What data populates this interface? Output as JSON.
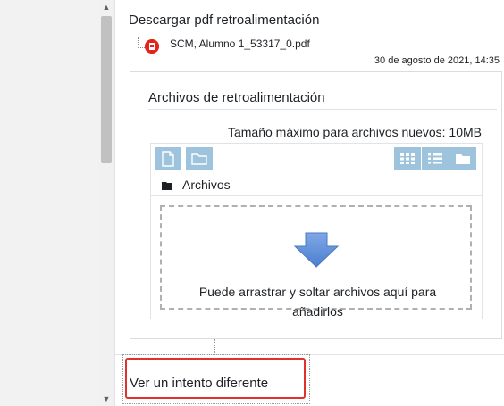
{
  "feedback_pdf": {
    "title": "Descargar pdf retroalimentación",
    "file_name": "SCM, Alumno 1_53317_0.pdf",
    "file_date": "30 de agosto de 2021, 14:35"
  },
  "feedback_files": {
    "title": "Archivos de retroalimentación",
    "max_size": "Tamaño máximo para archivos nuevos: 10MB",
    "path_label": "Archivos",
    "drop_text_line1": "Puede arrastrar y soltar archivos aquí para",
    "drop_text_line2": "añadirlos"
  },
  "actions": {
    "other_attempt": "Ver un intento diferente"
  },
  "icons": {
    "pdf": "pdf-icon",
    "new_file": "file-icon",
    "new_folder": "folder-icon",
    "view_icons": "grid-icon",
    "view_list": "list-icon",
    "view_tree": "folder-icon",
    "drop_arrow": "arrow-down-icon"
  },
  "colors": {
    "button": "#9ec3dd",
    "arrow": "#5b8ed6",
    "highlight": "#e0312c",
    "pdf": "#e5231b"
  }
}
